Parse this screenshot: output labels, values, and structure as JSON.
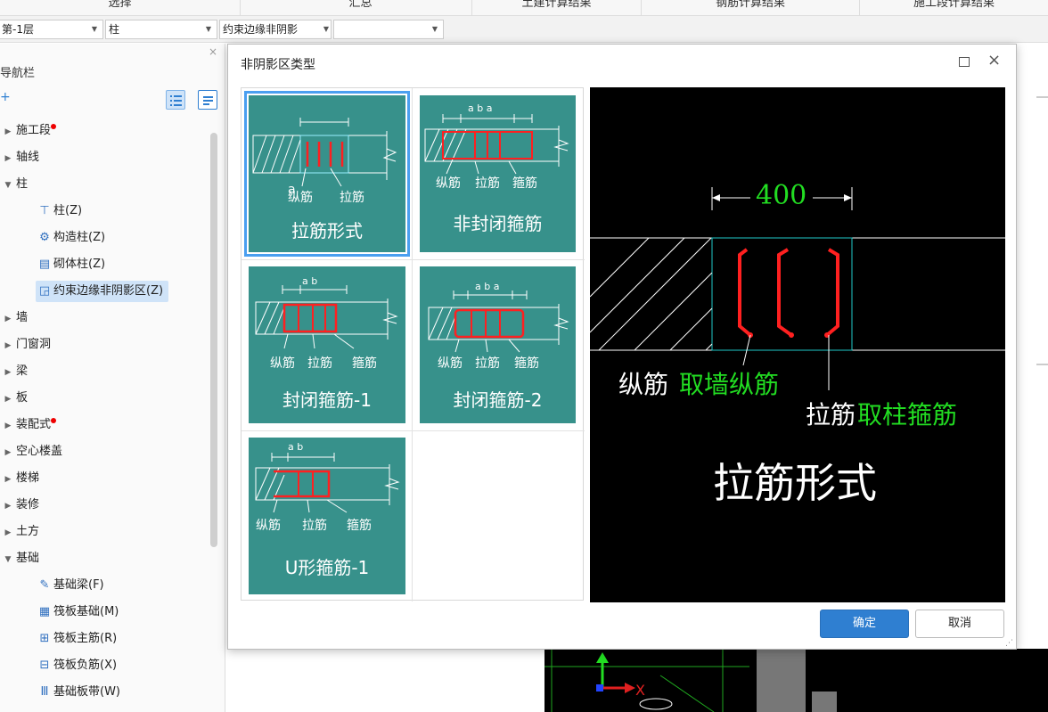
{
  "tabs": [
    "选择",
    "汇总",
    "土建计算结果",
    "钢筋计算结果",
    "施工段计算结果"
  ],
  "selectors": {
    "floor": "第-1层",
    "category": "柱",
    "type": "约束边缘非阴影",
    "extra": ""
  },
  "nav": {
    "title": "导航栏",
    "close": "×",
    "add_icon": "+",
    "items": [
      {
        "label": "施工段",
        "kind": "group",
        "dot": true,
        "expanded": false
      },
      {
        "label": "轴线",
        "kind": "group",
        "dot": false,
        "expanded": false
      },
      {
        "label": "柱",
        "kind": "group",
        "dot": false,
        "expanded": true
      },
      {
        "label": "柱(Z)",
        "kind": "child",
        "icon": "column-icon"
      },
      {
        "label": "构造柱(Z)",
        "kind": "child",
        "icon": "structural-column-icon"
      },
      {
        "label": "砌体柱(Z)",
        "kind": "child",
        "icon": "masonry-column-icon"
      },
      {
        "label": "约束边缘非阴影区(Z)",
        "kind": "child",
        "icon": "boundary-zone-icon",
        "selected": true
      },
      {
        "label": "墙",
        "kind": "group",
        "dot": false,
        "expanded": false
      },
      {
        "label": "门窗洞",
        "kind": "group",
        "dot": false,
        "expanded": false
      },
      {
        "label": "梁",
        "kind": "group",
        "dot": false,
        "expanded": false
      },
      {
        "label": "板",
        "kind": "group",
        "dot": false,
        "expanded": false
      },
      {
        "label": "装配式",
        "kind": "group",
        "dot": true,
        "expanded": false
      },
      {
        "label": "空心楼盖",
        "kind": "group",
        "dot": false,
        "expanded": false
      },
      {
        "label": "楼梯",
        "kind": "group",
        "dot": false,
        "expanded": false
      },
      {
        "label": "装修",
        "kind": "group",
        "dot": false,
        "expanded": false
      },
      {
        "label": "土方",
        "kind": "group",
        "dot": false,
        "expanded": false
      },
      {
        "label": "基础",
        "kind": "group",
        "dot": false,
        "expanded": true
      },
      {
        "label": "基础梁(F)",
        "kind": "child",
        "icon": "foundation-beam-icon"
      },
      {
        "label": "筏板基础(M)",
        "kind": "child",
        "icon": "raft-foundation-icon"
      },
      {
        "label": "筏板主筋(R)",
        "kind": "child",
        "icon": "raft-main-rebar-icon"
      },
      {
        "label": "筏板负筋(X)",
        "kind": "child",
        "icon": "raft-negative-rebar-icon"
      },
      {
        "label": "基础板带(W)",
        "kind": "child",
        "icon": "foundation-strip-icon"
      }
    ]
  },
  "dialog": {
    "title": "非阴影区类型",
    "max_icon": "maximize-icon",
    "close_icon": "×",
    "tiles": [
      {
        "title": "拉筋形式",
        "dim": "a",
        "labels": [
          "纵筋",
          "拉筋"
        ]
      },
      {
        "title": "非封闭箍筋",
        "dim": "a b a",
        "labels": [
          "纵筋",
          "拉筋",
          "箍筋"
        ]
      },
      {
        "title": "封闭箍筋-1",
        "dim": "a b",
        "labels": [
          "纵筋",
          "拉筋",
          "箍筋"
        ]
      },
      {
        "title": "封闭箍筋-2",
        "dim": "a b a",
        "labels": [
          "纵筋",
          "拉筋",
          "箍筋"
        ]
      },
      {
        "title": "U形箍筋-1",
        "dim": "a b",
        "labels": [
          "纵筋",
          "拉筋",
          "箍筋"
        ]
      }
    ],
    "preview": {
      "dimension": "400",
      "longitudinal": "纵筋",
      "longitudinal_value": "取墙纵筋",
      "tie": "拉筋",
      "tie_value": "取柱箍筋",
      "title": "拉筋形式"
    },
    "ok": "确定",
    "cancel": "取消"
  },
  "colors": {
    "tile_bg": "#37918b",
    "accent": "#2f7fd1",
    "rebar": "#ff2020",
    "preview_green": "#22dd22"
  }
}
